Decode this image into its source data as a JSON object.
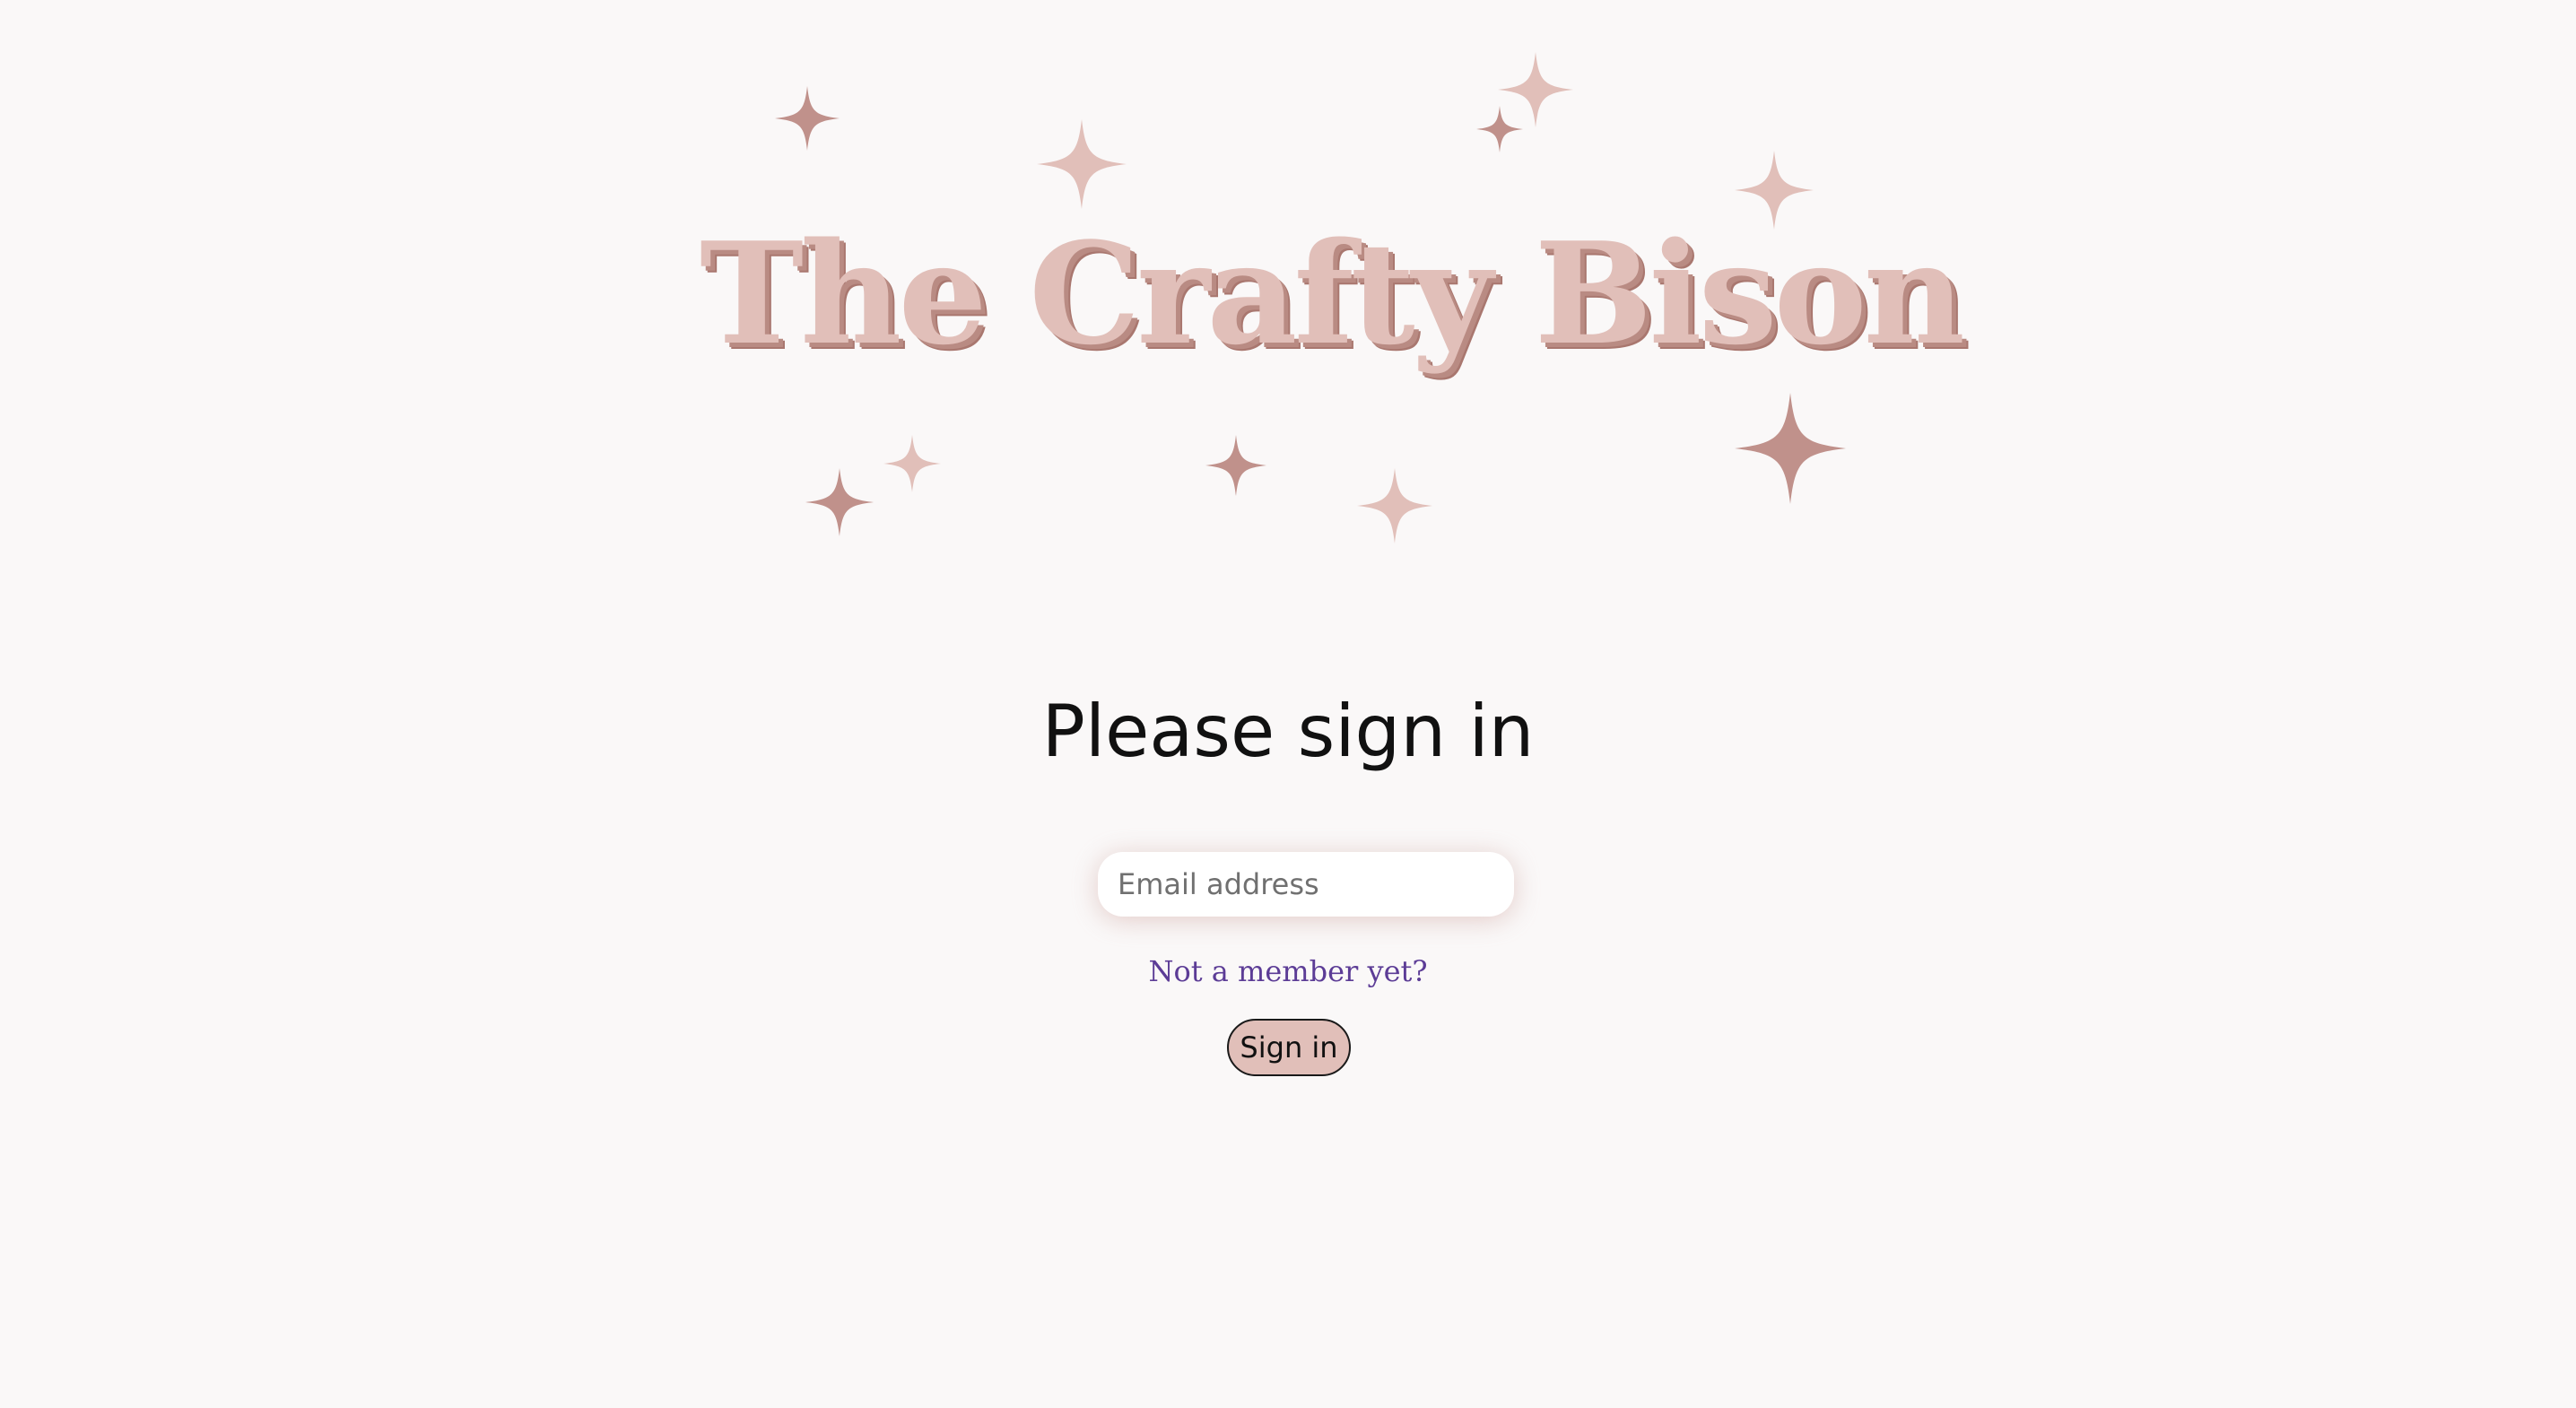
{
  "brand": {
    "name": "The Crafty Bison",
    "colors": {
      "background": "#faf8f8",
      "logo_fill": "#e1bfb9",
      "logo_shadow": "#a9776f",
      "sparkle_light": "#e1bfb9",
      "sparkle_dark": "#c0918b",
      "link": "#5c3c96",
      "button_bg": "#e1bfb9"
    }
  },
  "signin": {
    "title": "Please sign in",
    "email_placeholder": "Email address",
    "signup_link": "Not a member yet?",
    "submit_label": "Sign in"
  }
}
